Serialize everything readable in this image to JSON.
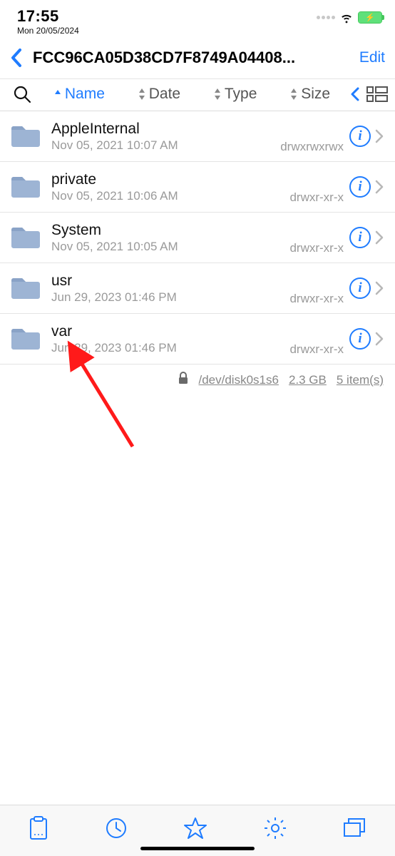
{
  "status": {
    "time": "17:55",
    "date": "Mon 20/05/2024"
  },
  "nav": {
    "title": "FCC96CA05D38CD7F8749A04408...",
    "edit_label": "Edit"
  },
  "sort": {
    "name_label": "Name",
    "date_label": "Date",
    "type_label": "Type",
    "size_label": "Size",
    "active": "name"
  },
  "files": [
    {
      "name": "AppleInternal",
      "date": "Nov 05, 2021 10:07 AM",
      "perm": "drwxrwxrwx"
    },
    {
      "name": "private",
      "date": "Nov 05, 2021 10:06 AM",
      "perm": "drwxr-xr-x"
    },
    {
      "name": "System",
      "date": "Nov 05, 2021 10:05 AM",
      "perm": "drwxr-xr-x"
    },
    {
      "name": "usr",
      "date": "Jun 29, 2023 01:46 PM",
      "perm": "drwxr-xr-x"
    },
    {
      "name": "var",
      "date": "Jun 29, 2023 01:46 PM",
      "perm": "drwxr-xr-x"
    }
  ],
  "footer": {
    "disk": "/dev/disk0s1s6",
    "size": "2.3 GB",
    "count": "5 item(s)"
  }
}
